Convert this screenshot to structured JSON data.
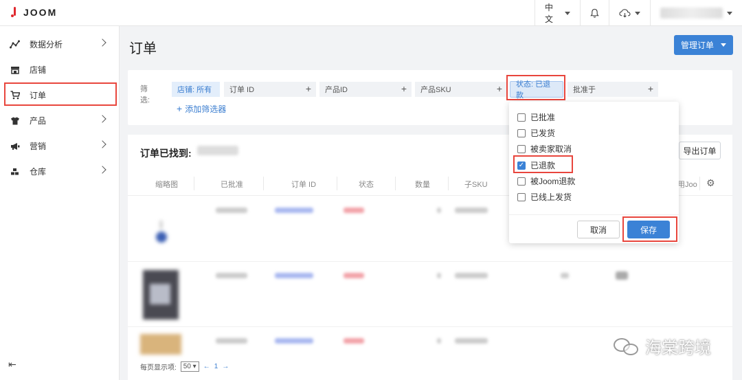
{
  "topbar": {
    "brand": "JOOM",
    "language": "中文",
    "notification_icon": "bell-icon",
    "cloud_icon": "cloud-download-icon"
  },
  "sidebar": {
    "items": [
      {
        "label": "数据分析",
        "icon": "analytics-icon",
        "has_chevron": true
      },
      {
        "label": "店铺",
        "icon": "store-icon",
        "has_chevron": false
      },
      {
        "label": "订单",
        "icon": "cart-icon",
        "has_chevron": false,
        "active": true
      },
      {
        "label": "产品",
        "icon": "shirt-icon",
        "has_chevron": true
      },
      {
        "label": "营销",
        "icon": "megaphone-icon",
        "has_chevron": true
      },
      {
        "label": "仓库",
        "icon": "warehouse-icon",
        "has_chevron": true
      }
    ],
    "collapse_icon": "collapse-left-icon"
  },
  "page": {
    "title": "订单",
    "manage_button": "管理订单"
  },
  "filters": {
    "label": "筛选:",
    "chips": [
      {
        "label": "店铺: 所有"
      },
      {
        "label": "订单 ID"
      },
      {
        "label": "产品ID"
      },
      {
        "label": "产品SKU"
      },
      {
        "label": "状态: 已退款"
      },
      {
        "label": "批准于"
      }
    ],
    "add_filter": "添加筛选器"
  },
  "orders": {
    "title": "订单已找到:",
    "export_button": "导出订单",
    "columns": [
      "缩略图",
      "已批准",
      "订单 ID",
      "状态",
      "数量",
      "子SKU",
      "用Joo"
    ],
    "per_page_label": "每页显示项:",
    "per_page_value": "50",
    "page": "1"
  },
  "status_dropdown": {
    "options": [
      {
        "label": "已批准",
        "checked": false
      },
      {
        "label": "已发货",
        "checked": false
      },
      {
        "label": "被卖家取消",
        "checked": false
      },
      {
        "label": "已退款",
        "checked": true
      },
      {
        "label": "被Joom退款",
        "checked": false
      },
      {
        "label": "已线上发货",
        "checked": false
      }
    ],
    "cancel": "取消",
    "save": "保存"
  },
  "watermark": "海棠跨境"
}
